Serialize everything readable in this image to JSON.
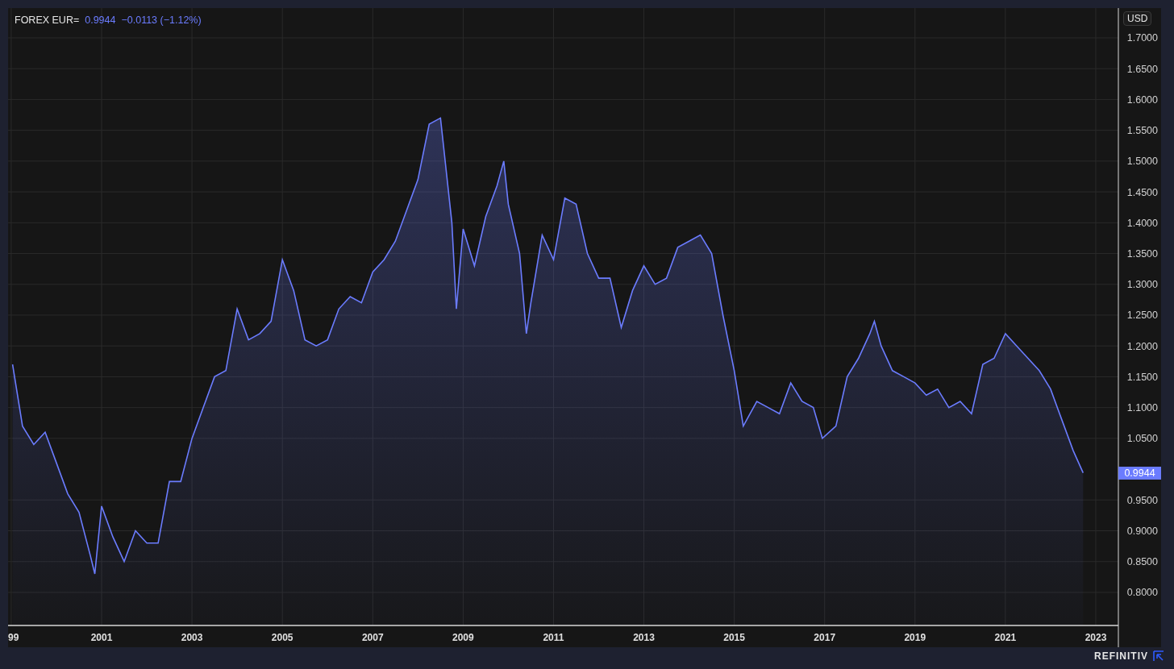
{
  "header": {
    "last_price": "0.9944",
    "change": "−0.0113 (−1.12%)"
  },
  "currency_button": "USD",
  "last_price_tag": "0.9944",
  "chart_data": {
    "type": "area",
    "x": [
      1999.03,
      1999.25,
      1999.5,
      1999.75,
      2000.0,
      2000.25,
      2000.5,
      2000.75,
      2000.85,
      2001.0,
      2001.25,
      2001.5,
      2001.75,
      2002.0,
      2002.25,
      2002.5,
      2002.75,
      2003.0,
      2003.25,
      2003.5,
      2003.75,
      2004.0,
      2004.25,
      2004.5,
      2004.75,
      2005.0,
      2005.25,
      2005.5,
      2005.75,
      2006.0,
      2006.25,
      2006.5,
      2006.75,
      2007.0,
      2007.25,
      2007.5,
      2007.75,
      2008.0,
      2008.25,
      2008.5,
      2008.75,
      2008.85,
      2009.0,
      2009.25,
      2009.5,
      2009.75,
      2009.9,
      2010.0,
      2010.25,
      2010.4,
      2010.5,
      2010.75,
      2011.0,
      2011.25,
      2011.5,
      2011.75,
      2012.0,
      2012.25,
      2012.5,
      2012.75,
      2013.0,
      2013.25,
      2013.5,
      2013.75,
      2014.0,
      2014.25,
      2014.5,
      2014.75,
      2015.0,
      2015.2,
      2015.5,
      2015.75,
      2016.0,
      2016.25,
      2016.5,
      2016.75,
      2016.95,
      2017.25,
      2017.5,
      2017.75,
      2018.0,
      2018.1,
      2018.25,
      2018.5,
      2018.75,
      2019.0,
      2019.25,
      2019.5,
      2019.75,
      2020.0,
      2020.25,
      2020.5,
      2020.75,
      2021.0,
      2021.25,
      2021.5,
      2021.75,
      2022.0,
      2022.25,
      2022.5,
      2022.72
    ],
    "series": [
      {
        "name": "FOREX EUR=",
        "color": "#6b7cff",
        "values": [
          1.17,
          1.07,
          1.04,
          1.06,
          1.01,
          0.96,
          0.93,
          0.86,
          0.83,
          0.94,
          0.89,
          0.85,
          0.9,
          0.88,
          0.88,
          0.98,
          0.98,
          1.05,
          1.1,
          1.15,
          1.16,
          1.26,
          1.21,
          1.22,
          1.24,
          1.34,
          1.29,
          1.21,
          1.2,
          1.21,
          1.26,
          1.28,
          1.27,
          1.32,
          1.34,
          1.37,
          1.42,
          1.47,
          1.56,
          1.57,
          1.4,
          1.26,
          1.39,
          1.33,
          1.41,
          1.46,
          1.5,
          1.43,
          1.35,
          1.22,
          1.27,
          1.38,
          1.34,
          1.44,
          1.43,
          1.35,
          1.31,
          1.31,
          1.23,
          1.29,
          1.33,
          1.3,
          1.31,
          1.36,
          1.37,
          1.38,
          1.35,
          1.25,
          1.16,
          1.07,
          1.11,
          1.1,
          1.09,
          1.14,
          1.11,
          1.1,
          1.05,
          1.07,
          1.15,
          1.18,
          1.22,
          1.24,
          1.2,
          1.16,
          1.15,
          1.14,
          1.12,
          1.13,
          1.1,
          1.11,
          1.09,
          1.17,
          1.18,
          1.22,
          1.2,
          1.18,
          1.16,
          1.13,
          1.08,
          1.03,
          0.994
        ]
      }
    ],
    "grid": true,
    "xlim": [
      1998.93,
      2023.5
    ],
    "ylim": [
      0.7463,
      1.7484
    ],
    "xticks": [
      {
        "value": 1999,
        "label": "99"
      },
      {
        "value": 2001,
        "label": "2001"
      },
      {
        "value": 2003,
        "label": "2003"
      },
      {
        "value": 2005,
        "label": "2005"
      },
      {
        "value": 2007,
        "label": "2007"
      },
      {
        "value": 2009,
        "label": "2009"
      },
      {
        "value": 2011,
        "label": "2011"
      },
      {
        "value": 2013,
        "label": "2013"
      },
      {
        "value": 2015,
        "label": "2015"
      },
      {
        "value": 2017,
        "label": "2017"
      },
      {
        "value": 2019,
        "label": "2019"
      },
      {
        "value": 2021,
        "label": "2021"
      },
      {
        "value": 2023,
        "label": "2023"
      }
    ],
    "yticks": [
      {
        "value": 0.8,
        "label": "0.8000"
      },
      {
        "value": 0.85,
        "label": "0.8500"
      },
      {
        "value": 0.9,
        "label": "0.9000"
      },
      {
        "value": 0.95,
        "label": "0.9500"
      },
      {
        "value": 1.05,
        "label": "1.0500"
      },
      {
        "value": 1.1,
        "label": "1.1000"
      },
      {
        "value": 1.15,
        "label": "1.1500"
      },
      {
        "value": 1.2,
        "label": "1.2000"
      },
      {
        "value": 1.25,
        "label": "1.2500"
      },
      {
        "value": 1.3,
        "label": "1.3000"
      },
      {
        "value": 1.35,
        "label": "1.3500"
      },
      {
        "value": 1.4,
        "label": "1.4000"
      },
      {
        "value": 1.45,
        "label": "1.4500"
      },
      {
        "value": 1.5,
        "label": "1.5000"
      },
      {
        "value": 1.55,
        "label": "1.5500"
      },
      {
        "value": 1.6,
        "label": "1.6000"
      },
      {
        "value": 1.65,
        "label": "1.6500"
      },
      {
        "value": 1.7,
        "label": "1.7000"
      }
    ]
  },
  "footer": {
    "brand": "REFINITIV"
  }
}
